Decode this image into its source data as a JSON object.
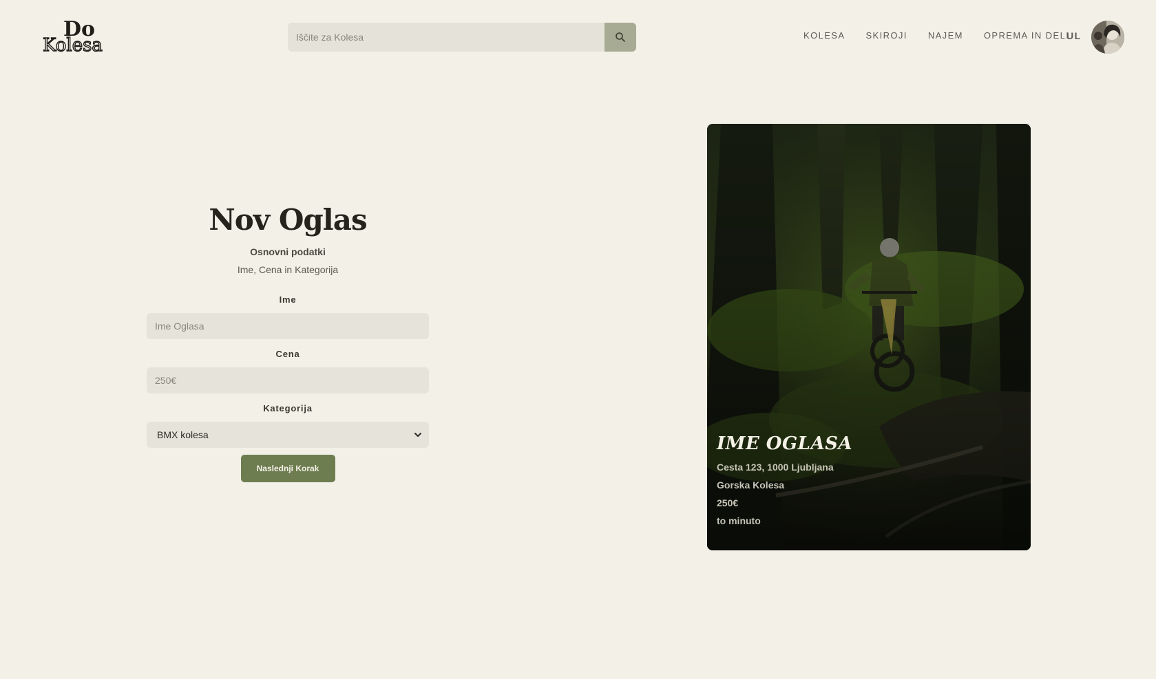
{
  "header": {
    "logo_top": "Do",
    "logo_bottom": "Kolesa",
    "search": {
      "placeholder": "Iščite za Kolesa"
    },
    "nav": [
      {
        "label": "KOLESA"
      },
      {
        "label": "SKIROJI"
      },
      {
        "label": "NAJEM"
      },
      {
        "label": "OPREMA IN DELI"
      }
    ],
    "user_initials": "UL"
  },
  "form": {
    "title": "Nov Oglas",
    "subtitle": "Osnovni podatki",
    "description": "Ime, Cena in Kategorija",
    "name_label": "Ime",
    "name_placeholder": "Ime Oglasa",
    "price_label": "Cena",
    "price_placeholder": "250€",
    "category_label": "Kategorija",
    "category_value": "BMX kolesa",
    "next_button": "Naslednji Korak"
  },
  "preview": {
    "title": "IME OGLASA",
    "address": "Cesta 123, 1000 Ljubljana",
    "category": "Gorska Kolesa",
    "price": "250€",
    "time": "to minuto"
  },
  "colors": {
    "background": "#f3f0e8",
    "accent": "#6d7d50",
    "search_button": "#a7ab94",
    "input_bg": "#e6e3db"
  }
}
